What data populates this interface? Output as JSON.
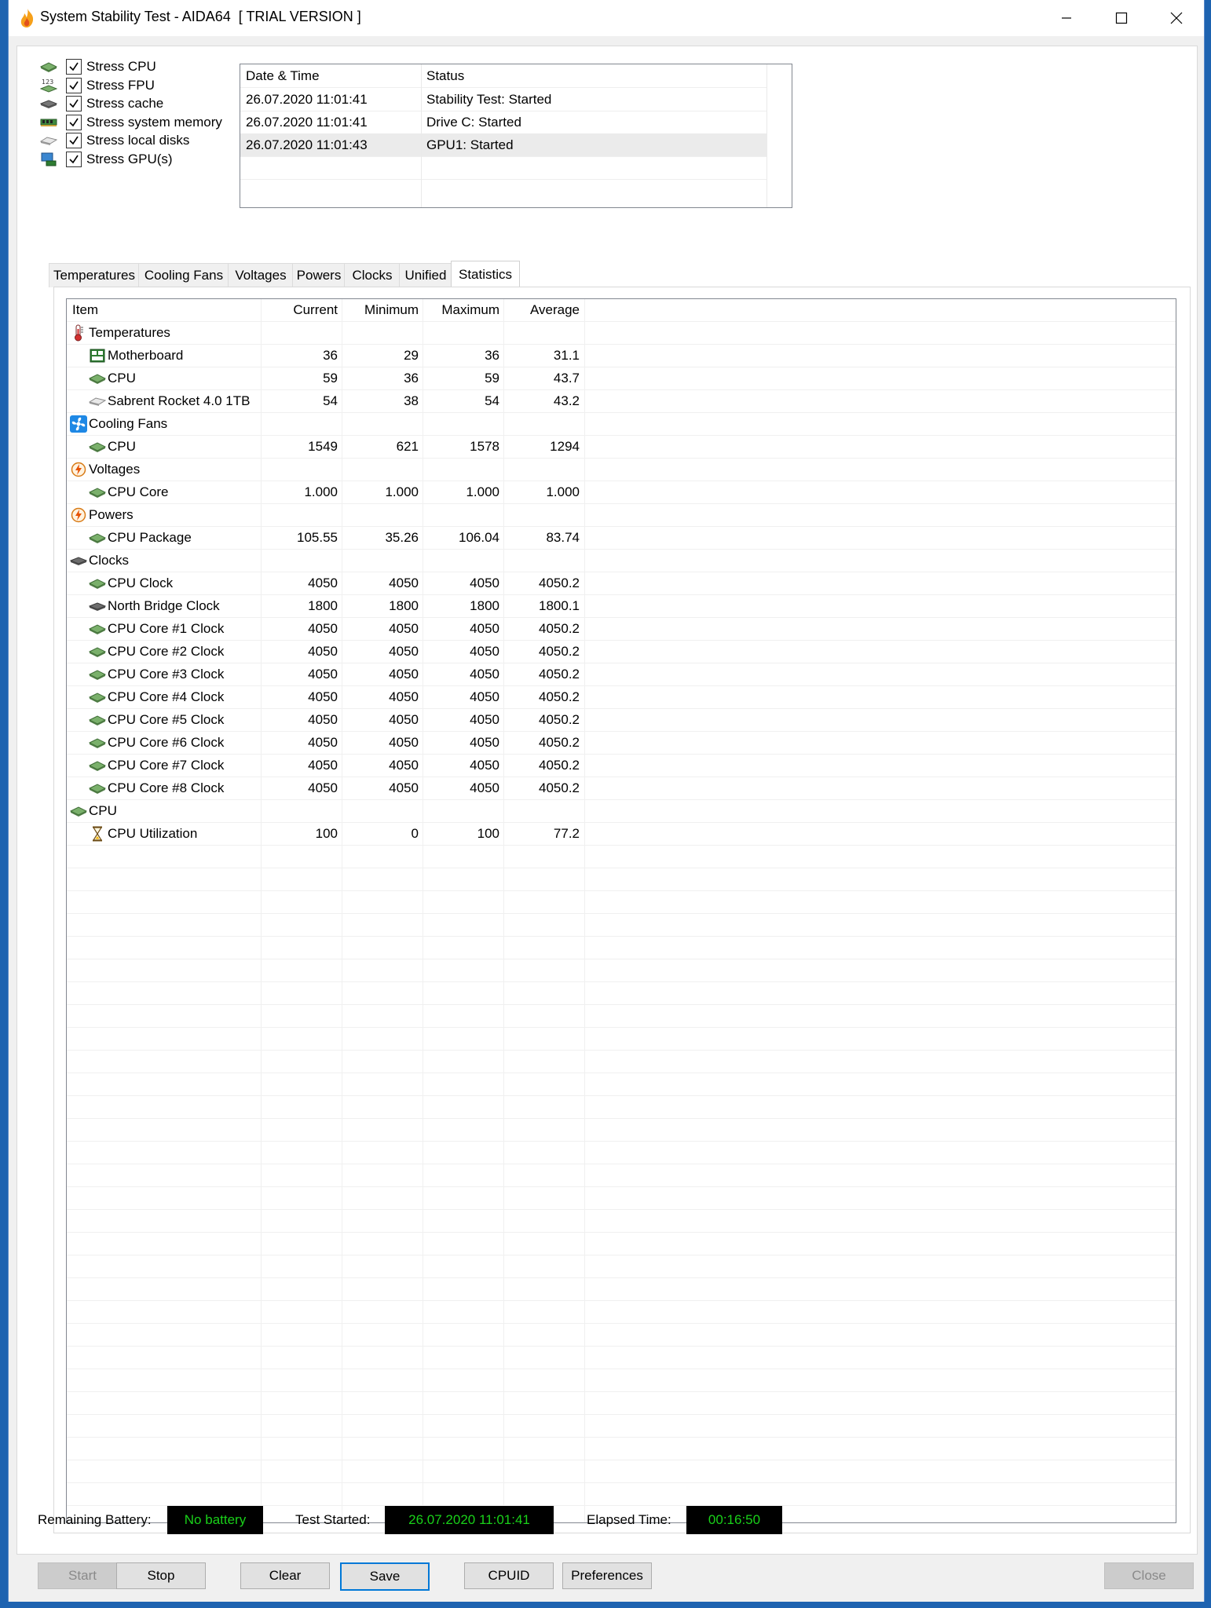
{
  "window": {
    "title": "System Stability Test - AIDA64  [ TRIAL VERSION ]"
  },
  "stress_options": [
    {
      "label": "Stress CPU",
      "checked": true,
      "icon": "cpu-chip-icon"
    },
    {
      "label": "Stress FPU",
      "checked": true,
      "icon": "fpu-123-icon"
    },
    {
      "label": "Stress cache",
      "checked": true,
      "icon": "cache-chip-icon"
    },
    {
      "label": "Stress system memory",
      "checked": true,
      "icon": "memory-module-icon"
    },
    {
      "label": "Stress local disks",
      "checked": true,
      "icon": "disk-drive-icon"
    },
    {
      "label": "Stress GPU(s)",
      "checked": true,
      "icon": "gpu-icon"
    }
  ],
  "log": {
    "columns": [
      "Date & Time",
      "Status"
    ],
    "rows": [
      {
        "datetime": "26.07.2020 11:01:41",
        "status": "Stability Test: Started"
      },
      {
        "datetime": "26.07.2020 11:01:41",
        "status": "Drive C: Started"
      },
      {
        "datetime": "26.07.2020 11:01:43",
        "status": "GPU1: Started"
      }
    ]
  },
  "tabs": [
    "Temperatures",
    "Cooling Fans",
    "Voltages",
    "Powers",
    "Clocks",
    "Unified",
    "Statistics"
  ],
  "active_tab": "Statistics",
  "stats": {
    "columns": [
      "Item",
      "Current",
      "Minimum",
      "Maximum",
      "Average"
    ],
    "rows": [
      {
        "type": "group",
        "label": "Temperatures",
        "icon": "thermometer-icon"
      },
      {
        "type": "item",
        "label": "Motherboard",
        "icon": "motherboard-icon",
        "current": "36",
        "min": "29",
        "max": "36",
        "avg": "31.1"
      },
      {
        "type": "item",
        "label": "CPU",
        "icon": "cpu-chip-icon",
        "current": "59",
        "min": "36",
        "max": "59",
        "avg": "43.7"
      },
      {
        "type": "item",
        "label": "Sabrent Rocket 4.0 1TB",
        "icon": "disk-drive-icon",
        "current": "54",
        "min": "38",
        "max": "54",
        "avg": "43.2"
      },
      {
        "type": "group",
        "label": "Cooling Fans",
        "icon": "fan-icon"
      },
      {
        "type": "item",
        "label": "CPU",
        "icon": "cpu-chip-icon",
        "current": "1549",
        "min": "621",
        "max": "1578",
        "avg": "1294"
      },
      {
        "type": "group",
        "label": "Voltages",
        "icon": "lightning-icon"
      },
      {
        "type": "item",
        "label": "CPU Core",
        "icon": "cpu-chip-icon",
        "current": "1.000",
        "min": "1.000",
        "max": "1.000",
        "avg": "1.000"
      },
      {
        "type": "group",
        "label": "Powers",
        "icon": "lightning-icon"
      },
      {
        "type": "item",
        "label": "CPU Package",
        "icon": "cpu-chip-icon",
        "current": "105.55",
        "min": "35.26",
        "max": "106.04",
        "avg": "83.74"
      },
      {
        "type": "group",
        "label": "Clocks",
        "icon": "chip-icon"
      },
      {
        "type": "item",
        "label": "CPU Clock",
        "icon": "cpu-chip-icon",
        "current": "4050",
        "min": "4050",
        "max": "4050",
        "avg": "4050.2"
      },
      {
        "type": "item",
        "label": "North Bridge Clock",
        "icon": "chip-icon",
        "current": "1800",
        "min": "1800",
        "max": "1800",
        "avg": "1800.1"
      },
      {
        "type": "item",
        "label": "CPU Core #1 Clock",
        "icon": "cpu-chip-icon",
        "current": "4050",
        "min": "4050",
        "max": "4050",
        "avg": "4050.2"
      },
      {
        "type": "item",
        "label": "CPU Core #2 Clock",
        "icon": "cpu-chip-icon",
        "current": "4050",
        "min": "4050",
        "max": "4050",
        "avg": "4050.2"
      },
      {
        "type": "item",
        "label": "CPU Core #3 Clock",
        "icon": "cpu-chip-icon",
        "current": "4050",
        "min": "4050",
        "max": "4050",
        "avg": "4050.2"
      },
      {
        "type": "item",
        "label": "CPU Core #4 Clock",
        "icon": "cpu-chip-icon",
        "current": "4050",
        "min": "4050",
        "max": "4050",
        "avg": "4050.2"
      },
      {
        "type": "item",
        "label": "CPU Core #5 Clock",
        "icon": "cpu-chip-icon",
        "current": "4050",
        "min": "4050",
        "max": "4050",
        "avg": "4050.2"
      },
      {
        "type": "item",
        "label": "CPU Core #6 Clock",
        "icon": "cpu-chip-icon",
        "current": "4050",
        "min": "4050",
        "max": "4050",
        "avg": "4050.2"
      },
      {
        "type": "item",
        "label": "CPU Core #7 Clock",
        "icon": "cpu-chip-icon",
        "current": "4050",
        "min": "4050",
        "max": "4050",
        "avg": "4050.2"
      },
      {
        "type": "item",
        "label": "CPU Core #8 Clock",
        "icon": "cpu-chip-icon",
        "current": "4050",
        "min": "4050",
        "max": "4050",
        "avg": "4050.2"
      },
      {
        "type": "group",
        "label": "CPU",
        "icon": "cpu-chip-icon"
      },
      {
        "type": "item",
        "label": "CPU Utilization",
        "icon": "hourglass-icon",
        "current": "100",
        "min": "0",
        "max": "100",
        "avg": "77.2"
      }
    ]
  },
  "status_bar": {
    "battery_label": "Remaining Battery:",
    "battery_value": "No battery",
    "started_label": "Test Started:",
    "started_value": "26.07.2020 11:01:41",
    "elapsed_label": "Elapsed Time:",
    "elapsed_value": "00:16:50"
  },
  "buttons": {
    "start": "Start",
    "stop": "Stop",
    "clear": "Clear",
    "save": "Save",
    "cpuid": "CPUID",
    "preferences": "Preferences",
    "close": "Close"
  },
  "colors": {
    "status_box_bg": "#000000",
    "status_box_text": "#19d119",
    "focus_border": "#0078d7",
    "desktop": "#1e63b0"
  }
}
